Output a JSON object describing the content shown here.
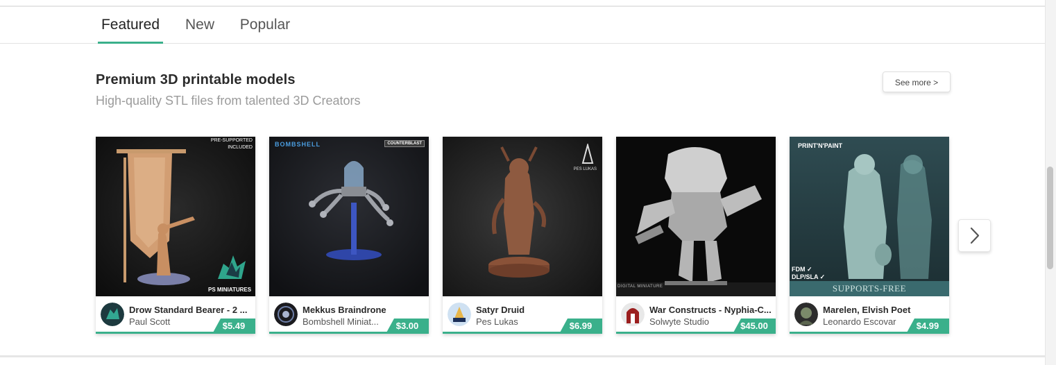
{
  "tabs": [
    {
      "label": "Featured",
      "active": true
    },
    {
      "label": "New",
      "active": false
    },
    {
      "label": "Popular",
      "active": false
    }
  ],
  "section": {
    "title": "Premium 3D printable models",
    "subtitle": "High-quality STL files from talented 3D Creators",
    "see_more_label": "See more >"
  },
  "accent_color": "#3ab08b",
  "cards": [
    {
      "title": "Drow Standard Bearer - 2 ...",
      "creator": "Paul Scott",
      "price": "$5.49",
      "overlay_top": "PRE-SUPPORTED",
      "overlay_top2": "INCLUDED",
      "overlay_bottom": "PS MINIATURES"
    },
    {
      "title": "Mekkus Braindrone",
      "creator": "Bombshell Miniat...",
      "price": "$3.00",
      "overlay_top": "BOMBSHELL",
      "overlay_top2": "COUNTERBLAST"
    },
    {
      "title": "Satyr Druid",
      "creator": "Pes Lukas",
      "price": "$6.99",
      "overlay_top": "PES LUKAS"
    },
    {
      "title": "War Constructs - Nyphia-C...",
      "creator": "Solwyte Studio",
      "price": "$45.00",
      "overlay_bottom": "DIGITAL MINIATURE"
    },
    {
      "title": "Marelen, Elvish Poet",
      "creator": "Leonardo Escovar",
      "price": "$4.99",
      "overlay_top": "PRINT'N'PAINT",
      "overlay_fdm": "FDM ✓",
      "overlay_dlp": "DLP/SLA ✓",
      "overlay_bottom": "SUPPORTS-FREE"
    }
  ],
  "icons": {
    "next": "chevron-right-icon"
  }
}
